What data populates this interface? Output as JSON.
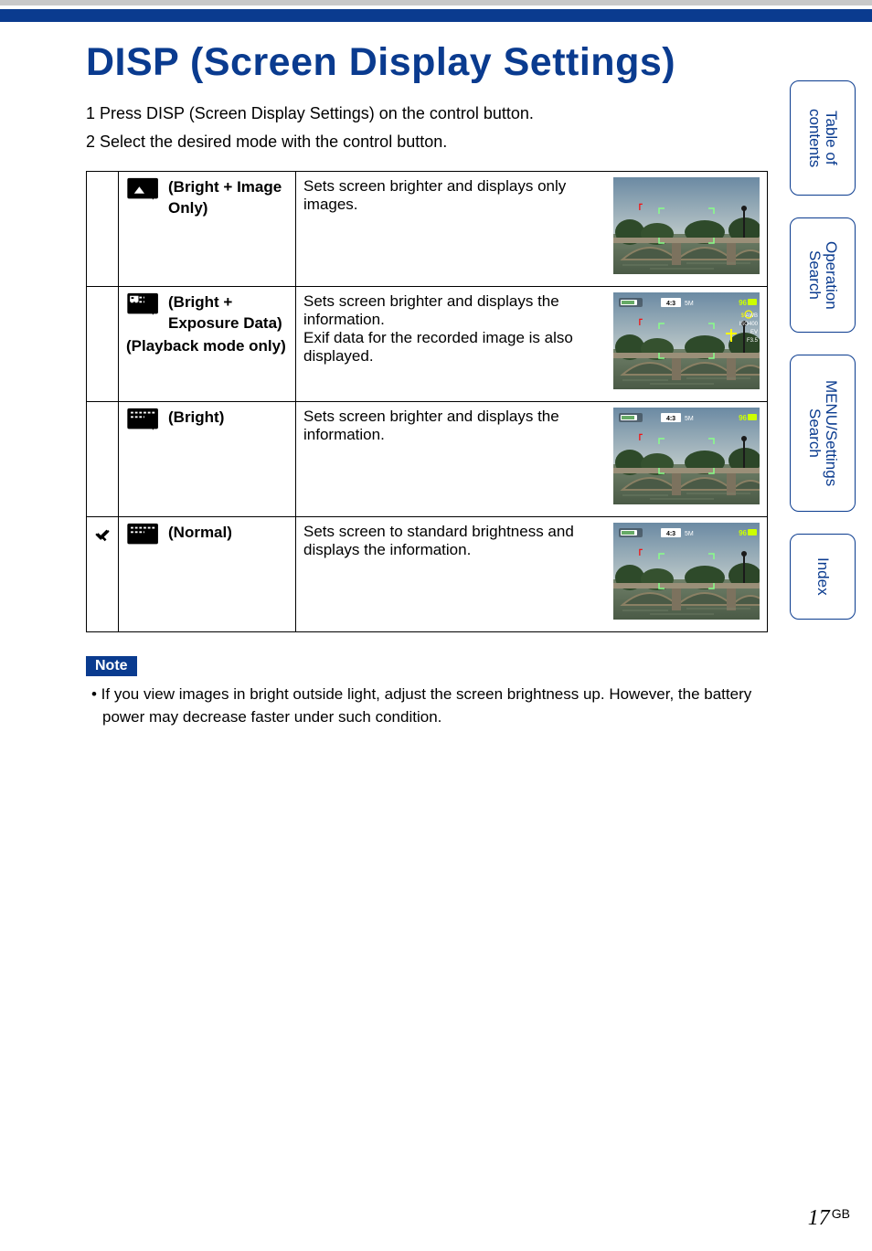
{
  "title": "DISP (Screen Display Settings)",
  "steps": [
    "1  Press DISP (Screen Display Settings) on the control button.",
    "2  Select the desired mode with the control button."
  ],
  "rows": [
    {
      "mark": "",
      "icon": "bright-image-only-icon",
      "label_prefix": "(Bright + Image Only)",
      "desc": "Sets screen brighter and displays only images.",
      "thumb_overlay": "none"
    },
    {
      "mark": "",
      "icon": "bright-exposure-icon",
      "label_prefix": "(Bright + Exposure Data)",
      "label_suffix": "(Playback mode only)",
      "desc": "Sets screen brighter and displays the information.\nExif data for the recorded image is also displayed.",
      "thumb_overlay": "exif"
    },
    {
      "mark": "",
      "icon": "bright-icon",
      "label_prefix": "(Bright)",
      "desc": "Sets screen brighter and displays the information.",
      "thumb_overlay": "info"
    },
    {
      "mark": "check",
      "icon": "normal-icon",
      "label_prefix": "(Normal)",
      "desc": "Sets screen to standard brightness and displays the information.",
      "thumb_overlay": "info"
    }
  ],
  "note_label": "Note",
  "note_text": "•  If you view images in bright outside light, adjust the screen brightness up. However, the battery power may decrease faster under such condition.",
  "tabs": {
    "toc": "Table of\ncontents",
    "op": "Operation\nSearch",
    "menu": "MENU/Settings\nSearch",
    "index": "Index"
  },
  "page_number": "17",
  "page_suffix": "GB",
  "thumb_labels": {
    "size": "5M",
    "count": "96",
    "iso": "ISO400",
    "ev": "EV",
    "f": "F3.5",
    "awb": "AWB"
  }
}
